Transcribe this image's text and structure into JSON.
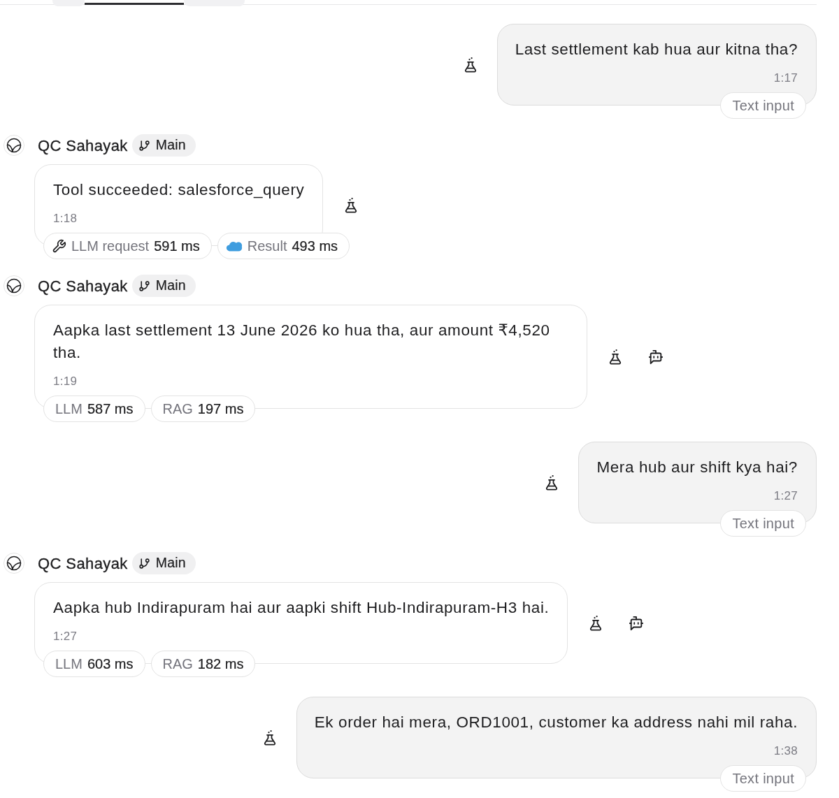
{
  "tabs": [
    {
      "selected": false
    },
    {
      "selected": true
    },
    {
      "selected": false
    }
  ],
  "messages": [
    {
      "kind": "user",
      "text": "Last settlement kab hua aur kitna tha?",
      "time": "1:17",
      "input_mode": "Text input"
    },
    {
      "kind": "tool",
      "agent": "QC Sahayak",
      "branch": "Main",
      "text": "Tool succeeded: salesforce_query",
      "time": "1:18",
      "timings": [
        {
          "kind": "request",
          "label": "LLM request",
          "value": "591 ms"
        },
        {
          "kind": "result",
          "label": "Result",
          "value": "493 ms"
        }
      ]
    },
    {
      "kind": "reply",
      "agent": "QC Sahayak",
      "branch": "Main",
      "text": "Aapka last settlement 13 June 2026 ko hua tha, aur amount ₹4,520 tha.",
      "time": "1:19",
      "timings": [
        {
          "kind": "plain",
          "label": "LLM",
          "value": "587 ms"
        },
        {
          "kind": "plain",
          "label": "RAG",
          "value": "197 ms"
        }
      ]
    },
    {
      "kind": "user",
      "text": "Mera hub aur shift kya hai?",
      "time": "1:27",
      "input_mode": "Text input"
    },
    {
      "kind": "reply",
      "agent": "QC Sahayak",
      "branch": "Main",
      "text": "Aapka hub Indirapuram hai aur aapki shift Hub-Indirapuram-H3 hai.",
      "time": "1:27",
      "timings": [
        {
          "kind": "plain",
          "label": "LLM",
          "value": "603 ms"
        },
        {
          "kind": "plain",
          "label": "RAG",
          "value": "182 ms"
        }
      ]
    },
    {
      "kind": "user",
      "text": "Ek order hai mera, ORD1001, customer ka address nahi mil raha.",
      "time": "1:38",
      "input_mode": "Text input"
    }
  ]
}
